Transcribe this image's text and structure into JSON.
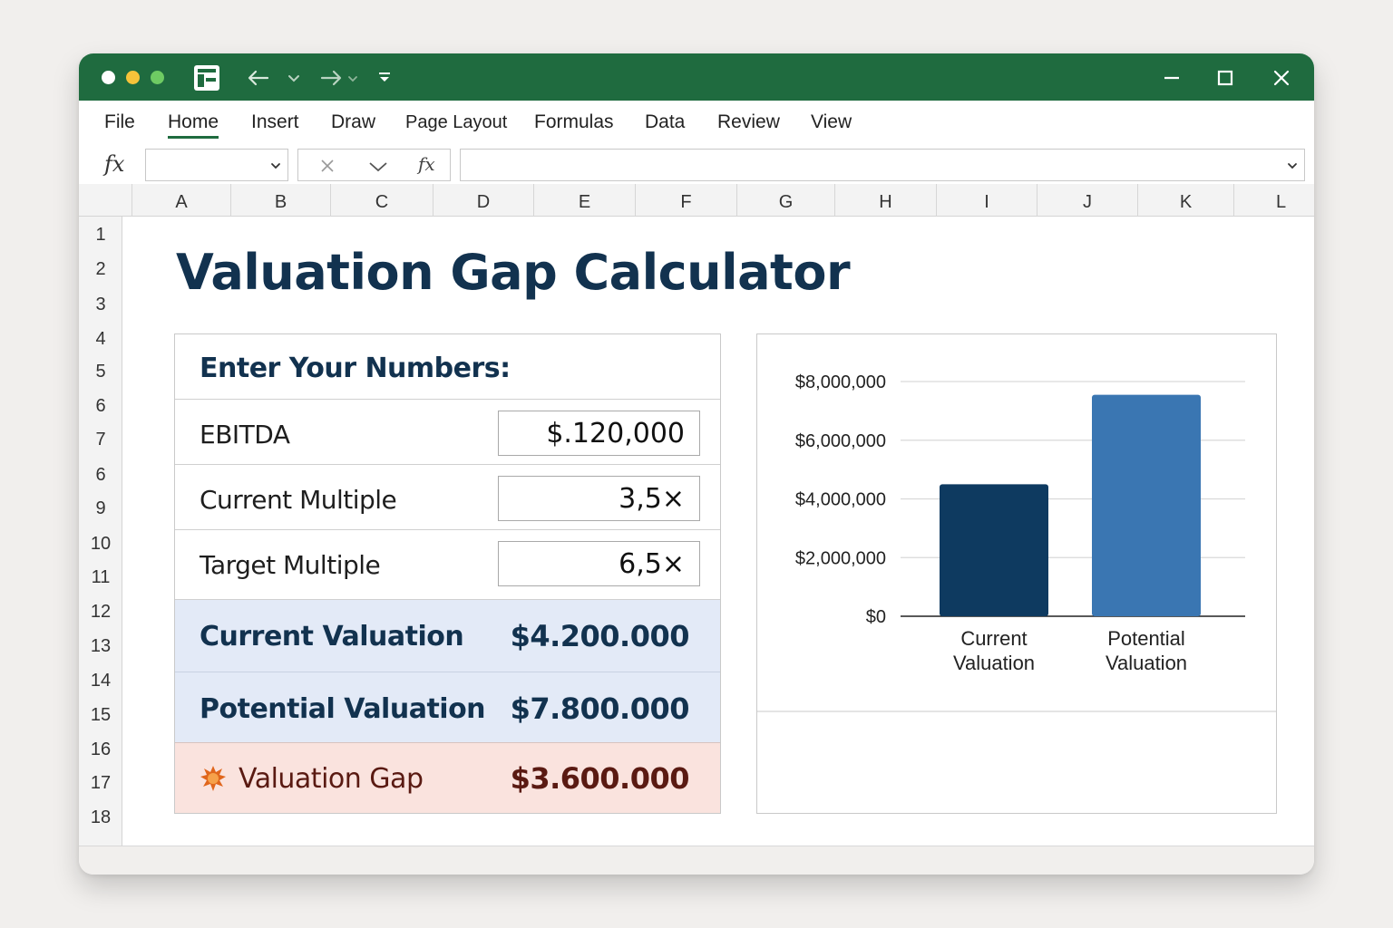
{
  "window": {
    "menu": [
      "File",
      "Home",
      "Insert",
      "Draw",
      "Page Layout",
      "Formulas",
      "Data",
      "Review",
      "View"
    ],
    "active_menu": "Home",
    "formula_bar": {
      "fx": "fx",
      "name_box": "",
      "formula": ""
    },
    "columns": [
      "A",
      "B",
      "C",
      "D",
      "E",
      "F",
      "G",
      "H",
      "I",
      "J",
      "K",
      "L"
    ],
    "rows": [
      "1",
      "2",
      "3",
      "4",
      "5",
      "6",
      "7",
      "6",
      "9",
      "10",
      "11",
      "12",
      "13",
      "14",
      "15",
      "16",
      "17",
      "18"
    ],
    "accent_color": "#1f6b3f"
  },
  "sheet": {
    "title": "Valuation Gap Calculator",
    "inputs_heading": "Enter Your Numbers:",
    "inputs": [
      {
        "label": "EBITDA",
        "value": "$.120,000"
      },
      {
        "label": "Current Multiple",
        "value": "3,5×"
      },
      {
        "label": "Target Multiple",
        "value": "6,5×"
      }
    ],
    "results": {
      "current": {
        "label": "Current Valuation",
        "value": "$4.200.000"
      },
      "potential": {
        "label": "Potential Valuation",
        "value": "$7.800.000"
      },
      "gap": {
        "label": "Valuation Gap",
        "value": "$3.600.000",
        "icon": "starburst-icon"
      }
    }
  },
  "chart_data": {
    "type": "bar",
    "categories": [
      [
        "Current",
        "Valuation"
      ],
      [
        "Potential",
        "Valuation"
      ]
    ],
    "values": [
      4500000,
      7550000
    ],
    "y_ticks": [
      "$0",
      "$2,000,000",
      "$4,000,000",
      "$6,000,000",
      "$8,000,000"
    ],
    "ylim": [
      0,
      8000000
    ],
    "colors": [
      "#0e3a60",
      "#3a76b2"
    ],
    "grid": true,
    "title": "",
    "xlabel": "",
    "ylabel": ""
  }
}
